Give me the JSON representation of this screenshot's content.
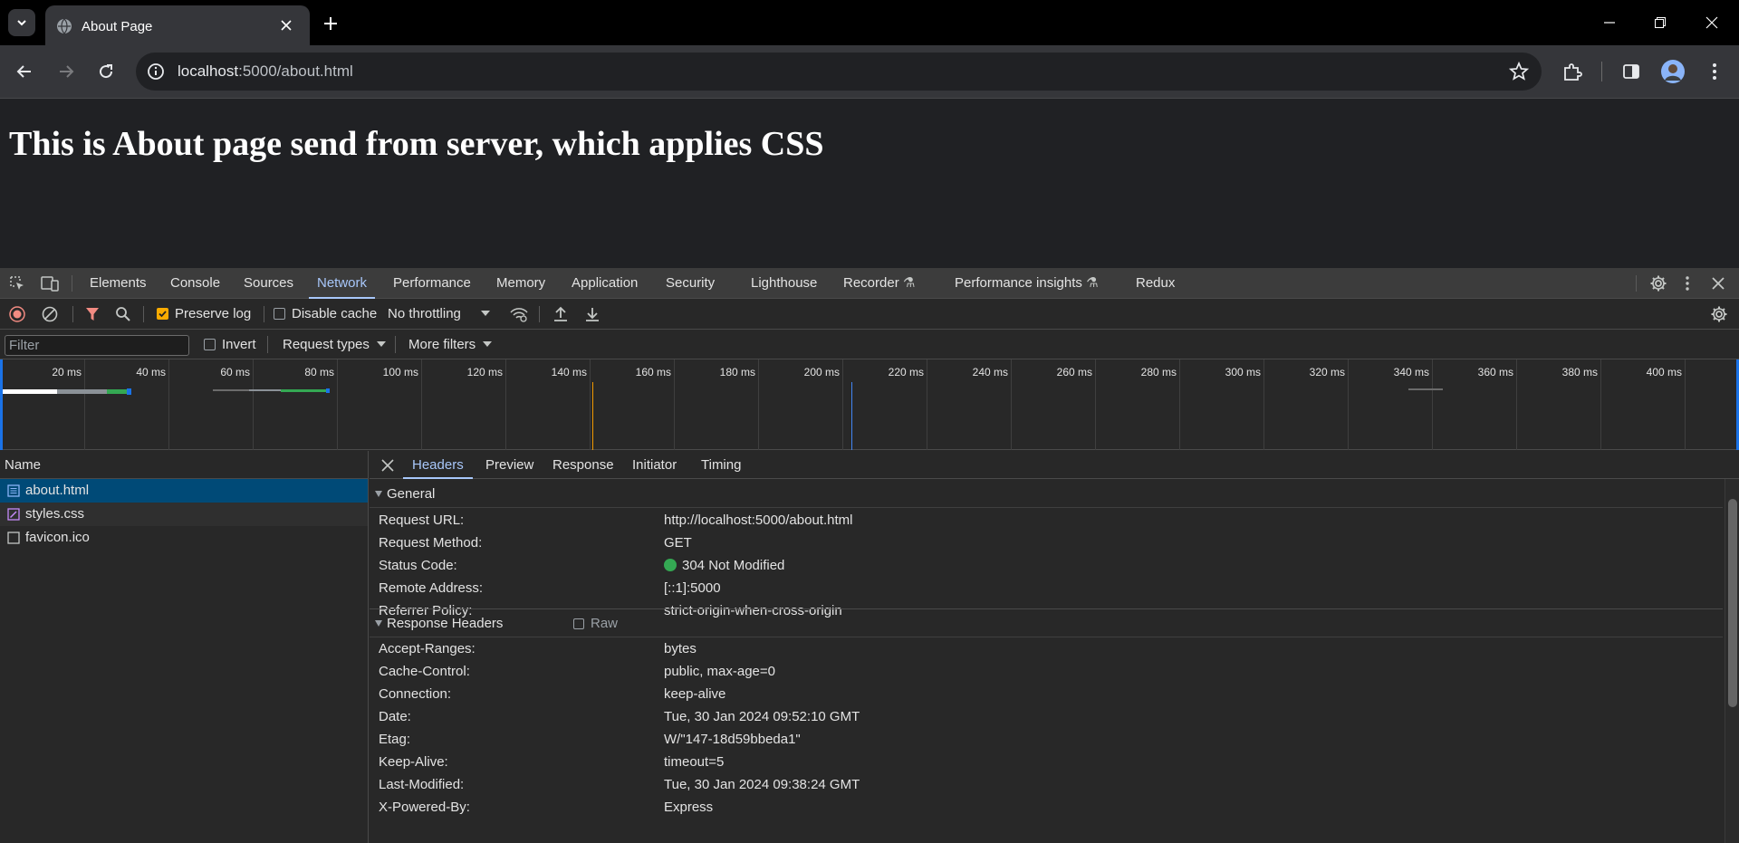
{
  "browser": {
    "tab_title": "About Page",
    "url_host": "localhost",
    "url_rest": ":5000/about.html"
  },
  "page": {
    "heading": "This is About page send from server, which applies CSS"
  },
  "devtools": {
    "tabs": [
      "Elements",
      "Console",
      "Sources",
      "Network",
      "Performance",
      "Memory",
      "Application",
      "Security",
      "Lighthouse",
      "Recorder",
      "Performance insights",
      "Redux"
    ],
    "active_tab": "Network",
    "toolbar": {
      "preserve_log": "Preserve log",
      "disable_cache": "Disable cache",
      "throttling": "No throttling"
    },
    "filter_bar": {
      "filter_placeholder": "Filter",
      "invert": "Invert",
      "request_types": "Request types",
      "more_filters": "More filters"
    },
    "timeline_ticks": [
      "20 ms",
      "40 ms",
      "60 ms",
      "80 ms",
      "100 ms",
      "120 ms",
      "140 ms",
      "160 ms",
      "180 ms",
      "200 ms",
      "220 ms",
      "240 ms",
      "260 ms",
      "280 ms",
      "300 ms",
      "320 ms",
      "340 ms",
      "360 ms",
      "380 ms",
      "400 ms",
      "4"
    ],
    "requests": {
      "header": "Name",
      "items": [
        "about.html",
        "styles.css",
        "favicon.ico"
      ]
    },
    "detail": {
      "tabs": [
        "Headers",
        "Preview",
        "Response",
        "Initiator",
        "Timing"
      ],
      "general_title": "General",
      "general": [
        {
          "k": "Request URL:",
          "v": "http://localhost:5000/about.html"
        },
        {
          "k": "Request Method:",
          "v": "GET"
        },
        {
          "k": "Status Code:",
          "v": "304 Not Modified"
        },
        {
          "k": "Remote Address:",
          "v": "[::1]:5000"
        },
        {
          "k": "Referrer Policy:",
          "v": "strict-origin-when-cross-origin"
        }
      ],
      "response_headers_title": "Response Headers",
      "raw_label": "Raw",
      "response_headers": [
        {
          "k": "Accept-Ranges:",
          "v": "bytes"
        },
        {
          "k": "Cache-Control:",
          "v": "public, max-age=0"
        },
        {
          "k": "Connection:",
          "v": "keep-alive"
        },
        {
          "k": "Date:",
          "v": "Tue, 30 Jan 2024 09:52:10 GMT"
        },
        {
          "k": "Etag:",
          "v": "W/\"147-18d59bbeda1\""
        },
        {
          "k": "Keep-Alive:",
          "v": "timeout=5"
        },
        {
          "k": "Last-Modified:",
          "v": "Tue, 30 Jan 2024 09:38:24 GMT"
        },
        {
          "k": "X-Powered-By:",
          "v": "Express"
        }
      ]
    }
  }
}
